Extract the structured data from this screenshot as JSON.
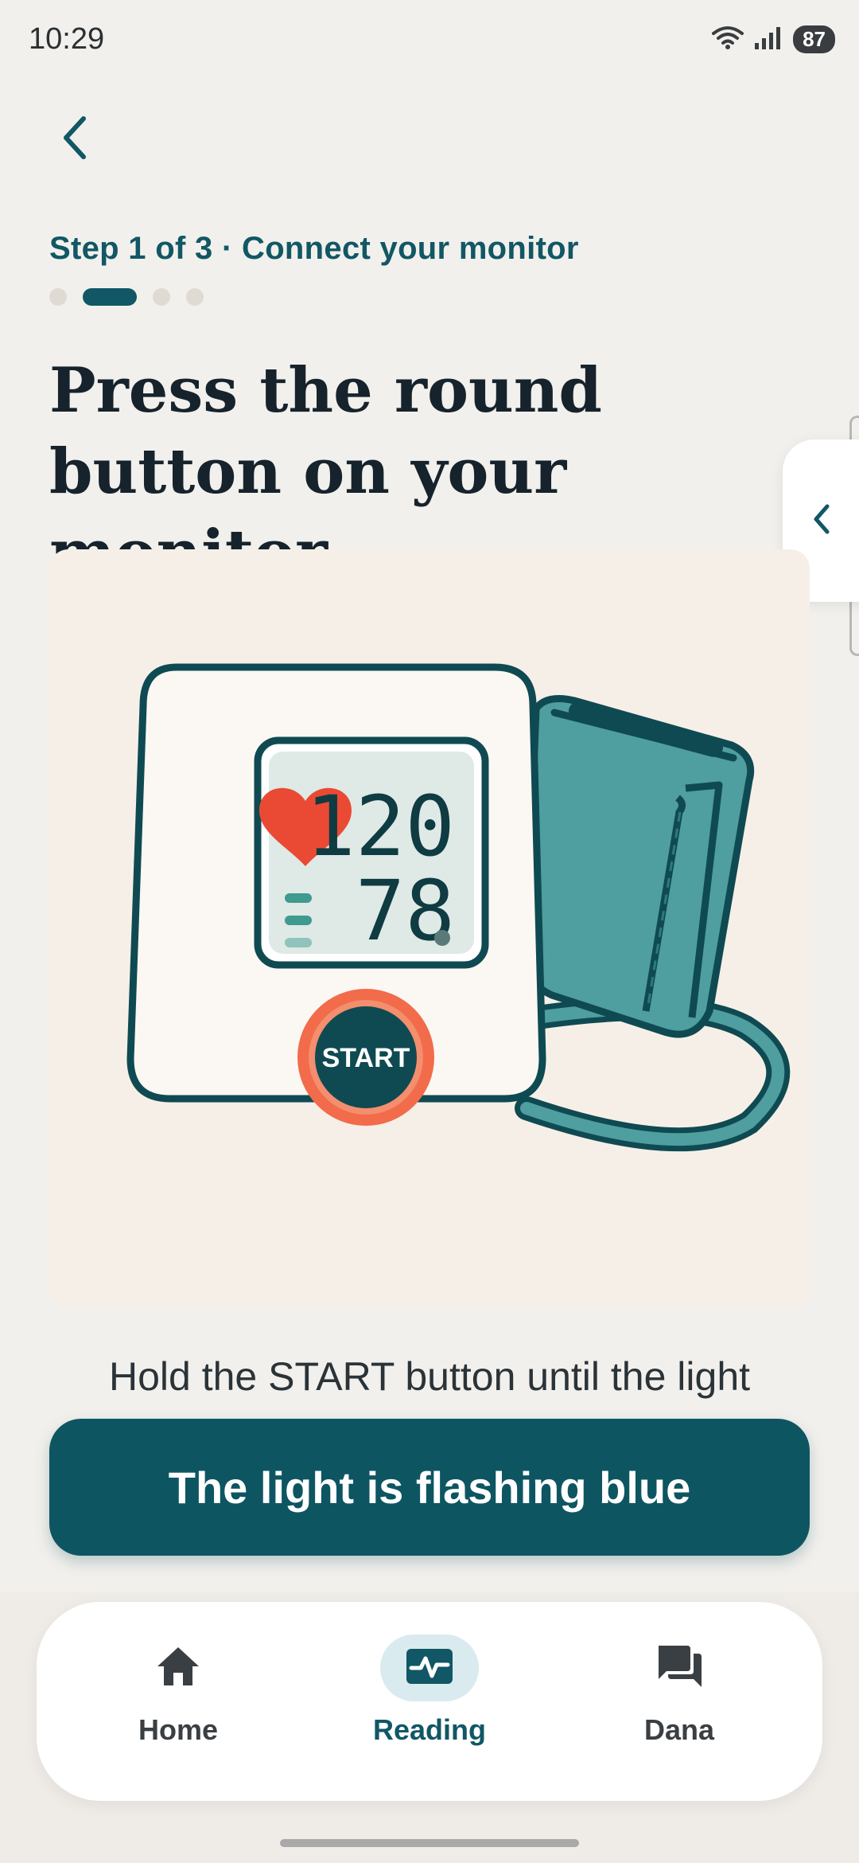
{
  "status_bar": {
    "time": "10:29",
    "battery": "87",
    "icons": [
      "wifi-icon",
      "signal-icon",
      "battery-icon"
    ]
  },
  "header": {
    "back_icon": "chevron-left-icon"
  },
  "progress": {
    "step_label": "Step 1 of 3 · Connect your monitor",
    "current_step": 2,
    "total_dots": 4
  },
  "title": "Press the round button on your monitor",
  "illustration": {
    "systolic": "120",
    "diastolic": "78",
    "button_label": "START"
  },
  "instruction": "Hold the START button until the light",
  "primary_button": {
    "label": "The light is flashing blue"
  },
  "side_handle": {
    "icon": "chevron-left-icon"
  },
  "bottom_nav": {
    "items": [
      {
        "label": "Home",
        "icon": "home-icon"
      },
      {
        "label": "Reading",
        "icon": "pulse-icon",
        "active": true
      },
      {
        "label": "Dana",
        "icon": "chat-icon"
      }
    ]
  },
  "colors": {
    "primary": "#0e5562",
    "accent": "#f26b4a",
    "background": "#f2f0ec",
    "cuff": "#4f9ea0"
  }
}
